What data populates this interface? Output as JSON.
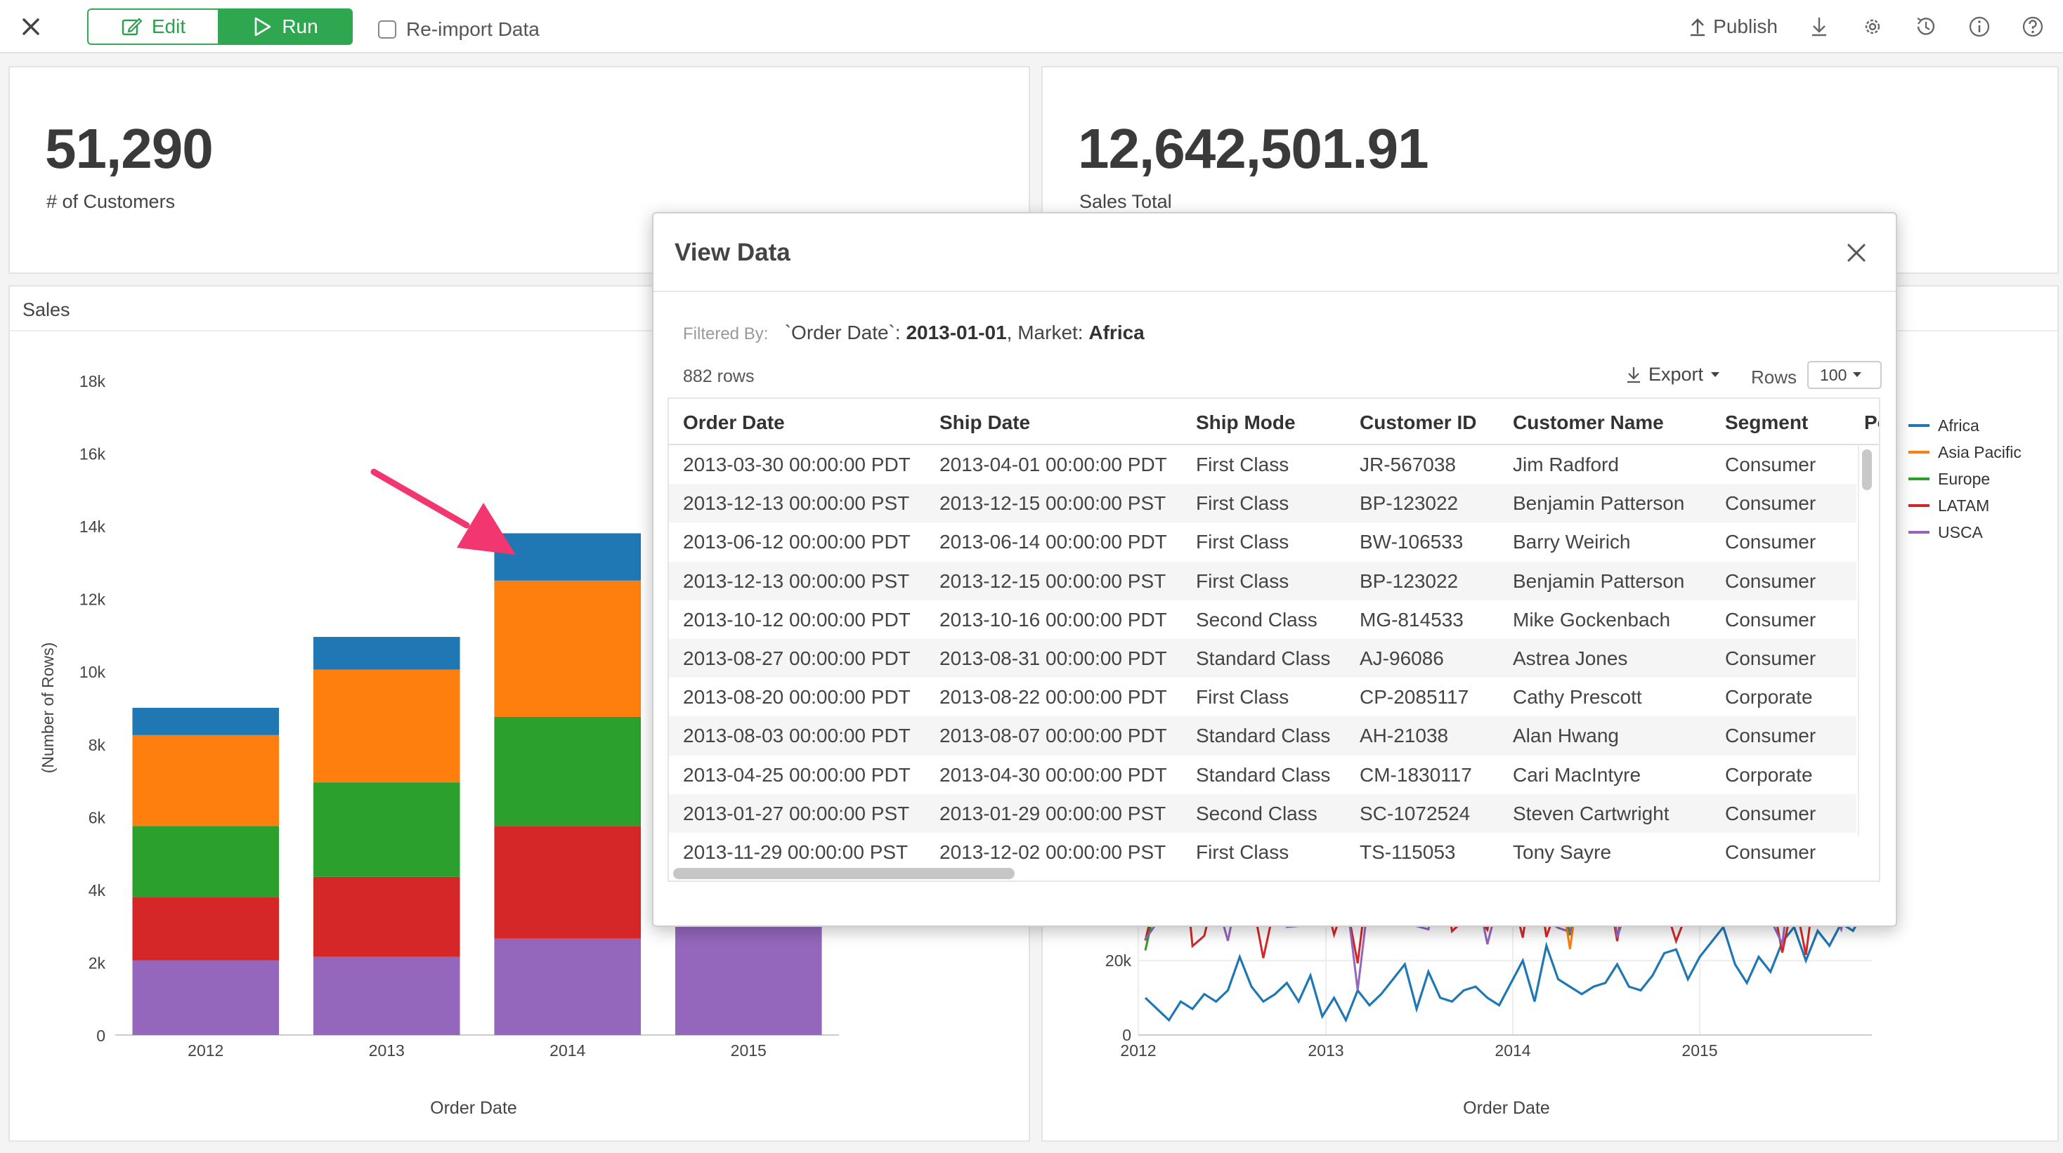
{
  "toolbar": {
    "edit_label": "Edit",
    "run_label": "Run",
    "reimport_label": "Re-import Data",
    "publish_label": "Publish",
    "icons": [
      "close-icon",
      "edit-icon",
      "play-icon",
      "upload-icon",
      "download-icon",
      "gear-icon",
      "history-icon",
      "info-icon",
      "help-icon"
    ]
  },
  "kpis": [
    {
      "value": "51,290",
      "label": "# of Customers"
    },
    {
      "value": "12,642,501.91",
      "label": "Sales Total"
    }
  ],
  "sales_panel": {
    "title": "Sales"
  },
  "colors": {
    "africa": "#1f77b4",
    "asia_pacific": "#ff7f0e",
    "europe": "#2ca02c",
    "latam": "#d62728",
    "usca": "#9467bd",
    "accent_green": "#2fa650",
    "arrow": "#f2366f"
  },
  "chart_data": [
    {
      "type": "bar",
      "stacked": true,
      "categories": [
        "2012",
        "2013",
        "2014",
        "2015"
      ],
      "xlabel": "Order Date",
      "ylabel": "(Number of Rows)",
      "ylim": [
        0,
        18000
      ],
      "yticks": [
        "0",
        "2k",
        "4k",
        "6k",
        "8k",
        "10k",
        "12k",
        "14k",
        "16k",
        "18k"
      ],
      "series": [
        {
          "values": [
            2050,
            2150,
            2650,
            3300
          ]
        },
        {
          "values": [
            1750,
            2200,
            3100,
            null
          ]
        },
        {
          "values": [
            1950,
            2600,
            3000,
            null
          ]
        },
        {
          "values": [
            2500,
            3100,
            3750,
            null
          ]
        },
        {
          "values": [
            750,
            900,
            1300,
            null
          ]
        }
      ]
    },
    {
      "type": "line",
      "x_ticks": [
        "2012",
        "2013",
        "2014",
        "2015"
      ],
      "xlabel": "Order Date",
      "y_ticks_visible": [
        "0",
        "20k"
      ],
      "legend": [
        "Africa",
        "Asia Pacific",
        "Europe",
        "LATAM",
        "USCA"
      ],
      "legend_position": "right",
      "africa_series_visible": [
        10,
        7,
        4,
        9,
        7,
        11,
        9,
        12,
        21,
        13,
        9,
        11,
        14,
        9,
        16,
        5,
        10,
        4,
        12,
        8,
        11,
        15,
        19,
        7,
        17,
        10,
        9,
        12,
        13,
        10,
        8,
        14,
        20,
        9,
        24,
        15,
        13,
        11,
        13,
        14,
        19,
        13,
        12,
        16,
        22,
        23,
        15,
        21,
        25,
        29,
        19,
        14,
        21,
        17,
        25,
        29,
        20,
        28,
        24,
        30,
        28,
        34
      ]
    }
  ],
  "modal": {
    "title": "View Data",
    "filter_prefix": "Filtered By:",
    "filter_text": "`Order Date`:",
    "filter_date": "2013-01-01",
    "filter_market_label": ", Market:",
    "filter_market": "Africa",
    "row_count": "882 rows",
    "export_label": "Export",
    "rows_label": "Rows",
    "rows_value": "100",
    "columns": [
      "Order Date",
      "Ship Date",
      "Ship Mode",
      "Customer ID",
      "Customer Name",
      "Segment",
      "Po"
    ],
    "rows": [
      [
        "2013-03-30 00:00:00 PDT",
        "2013-04-01 00:00:00 PDT",
        "First Class",
        "JR-567038",
        "Jim Radford",
        "Consumer"
      ],
      [
        "2013-12-13 00:00:00 PST",
        "2013-12-15 00:00:00 PST",
        "First Class",
        "BP-123022",
        "Benjamin Patterson",
        "Consumer"
      ],
      [
        "2013-06-12 00:00:00 PDT",
        "2013-06-14 00:00:00 PDT",
        "First Class",
        "BW-106533",
        "Barry Weirich",
        "Consumer"
      ],
      [
        "2013-12-13 00:00:00 PST",
        "2013-12-15 00:00:00 PST",
        "First Class",
        "BP-123022",
        "Benjamin Patterson",
        "Consumer"
      ],
      [
        "2013-10-12 00:00:00 PDT",
        "2013-10-16 00:00:00 PDT",
        "Second Class",
        "MG-814533",
        "Mike Gockenbach",
        "Consumer"
      ],
      [
        "2013-08-27 00:00:00 PDT",
        "2013-08-31 00:00:00 PDT",
        "Standard Class",
        "AJ-96086",
        "Astrea Jones",
        "Consumer"
      ],
      [
        "2013-08-20 00:00:00 PDT",
        "2013-08-22 00:00:00 PDT",
        "First Class",
        "CP-2085117",
        "Cathy Prescott",
        "Corporate"
      ],
      [
        "2013-08-03 00:00:00 PDT",
        "2013-08-07 00:00:00 PDT",
        "Standard Class",
        "AH-21038",
        "Alan Hwang",
        "Consumer"
      ],
      [
        "2013-04-25 00:00:00 PDT",
        "2013-04-30 00:00:00 PDT",
        "Standard Class",
        "CM-1830117",
        "Cari MacIntyre",
        "Corporate"
      ],
      [
        "2013-01-27 00:00:00 PST",
        "2013-01-29 00:00:00 PST",
        "Second Class",
        "SC-1072524",
        "Steven Cartwright",
        "Consumer"
      ],
      [
        "2013-11-29 00:00:00 PST",
        "2013-12-02 00:00:00 PST",
        "First Class",
        "TS-115053",
        "Tony Sayre",
        "Consumer"
      ]
    ]
  }
}
